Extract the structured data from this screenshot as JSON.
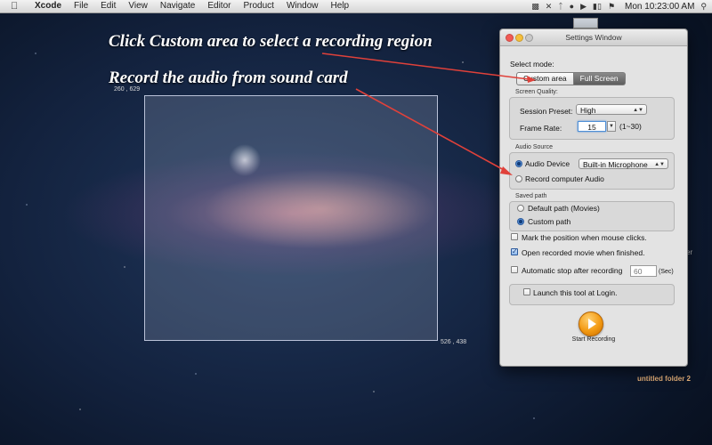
{
  "menubar": {
    "app_name": "Xcode",
    "menus": [
      "File",
      "Edit",
      "View",
      "Navigate",
      "Editor",
      "Product",
      "Window",
      "Help"
    ],
    "clock": "Mon 10:23:00 AM",
    "status_icons": [
      "keychain-icon",
      "tool-icon",
      "bluetooth-icon",
      "wifi-icon",
      "volume-icon",
      "battery-icon",
      "flag-icon",
      "spotlight-icon"
    ]
  },
  "captions": {
    "custom_area": "Click Custom  area  to select a recording region",
    "audio": "Record the audio from sound card"
  },
  "region": {
    "top_left_coord": "260 , 629",
    "bottom_right_coord": "526 , 438"
  },
  "desktop": {
    "folder_label": "untitled folder 2",
    "partial_label": "er"
  },
  "window": {
    "title": "Settings Window",
    "select_mode_label": "Select mode:",
    "mode_custom": "Custom area",
    "mode_full": "Full Screen",
    "screen_quality_label": "Screen  Quality:",
    "session_preset_label": "Session Preset:",
    "session_preset_value": "High",
    "frame_rate_label": "Frame Rate:",
    "frame_rate_value": "15",
    "frame_rate_range": "(1~30)",
    "audio_source_label": "Audio Source",
    "audio_device_label": "Audio Device",
    "audio_device_value": "Built-in Microphone",
    "record_computer_audio": "Record computer Audio",
    "saved_path_label": "Saved path",
    "default_path": "Default path (Movies)",
    "custom_path": "Custom path",
    "mark_position": "Mark the position when mouse clicks.",
    "open_recorded": "Open recorded movie when finished.",
    "auto_stop": "Automatic stop after recording",
    "auto_stop_value": "60",
    "auto_stop_unit": "(Sec)",
    "launch_login": "Launch this tool at Login.",
    "start_recording": "Start Recording"
  },
  "state": {
    "mode_selected": "Custom area",
    "audio_device_selected": true,
    "record_computer_audio_selected": false,
    "default_path_selected": false,
    "custom_path_selected": true,
    "mark_position_checked": false,
    "open_recorded_checked": true,
    "auto_stop_checked": false,
    "launch_login_checked": false
  },
  "colors": {
    "annotation_arrow": "#e0413a",
    "caption_text": "#ffffff",
    "start_button": "#f39a12",
    "folder_label": "#e9b37b"
  }
}
